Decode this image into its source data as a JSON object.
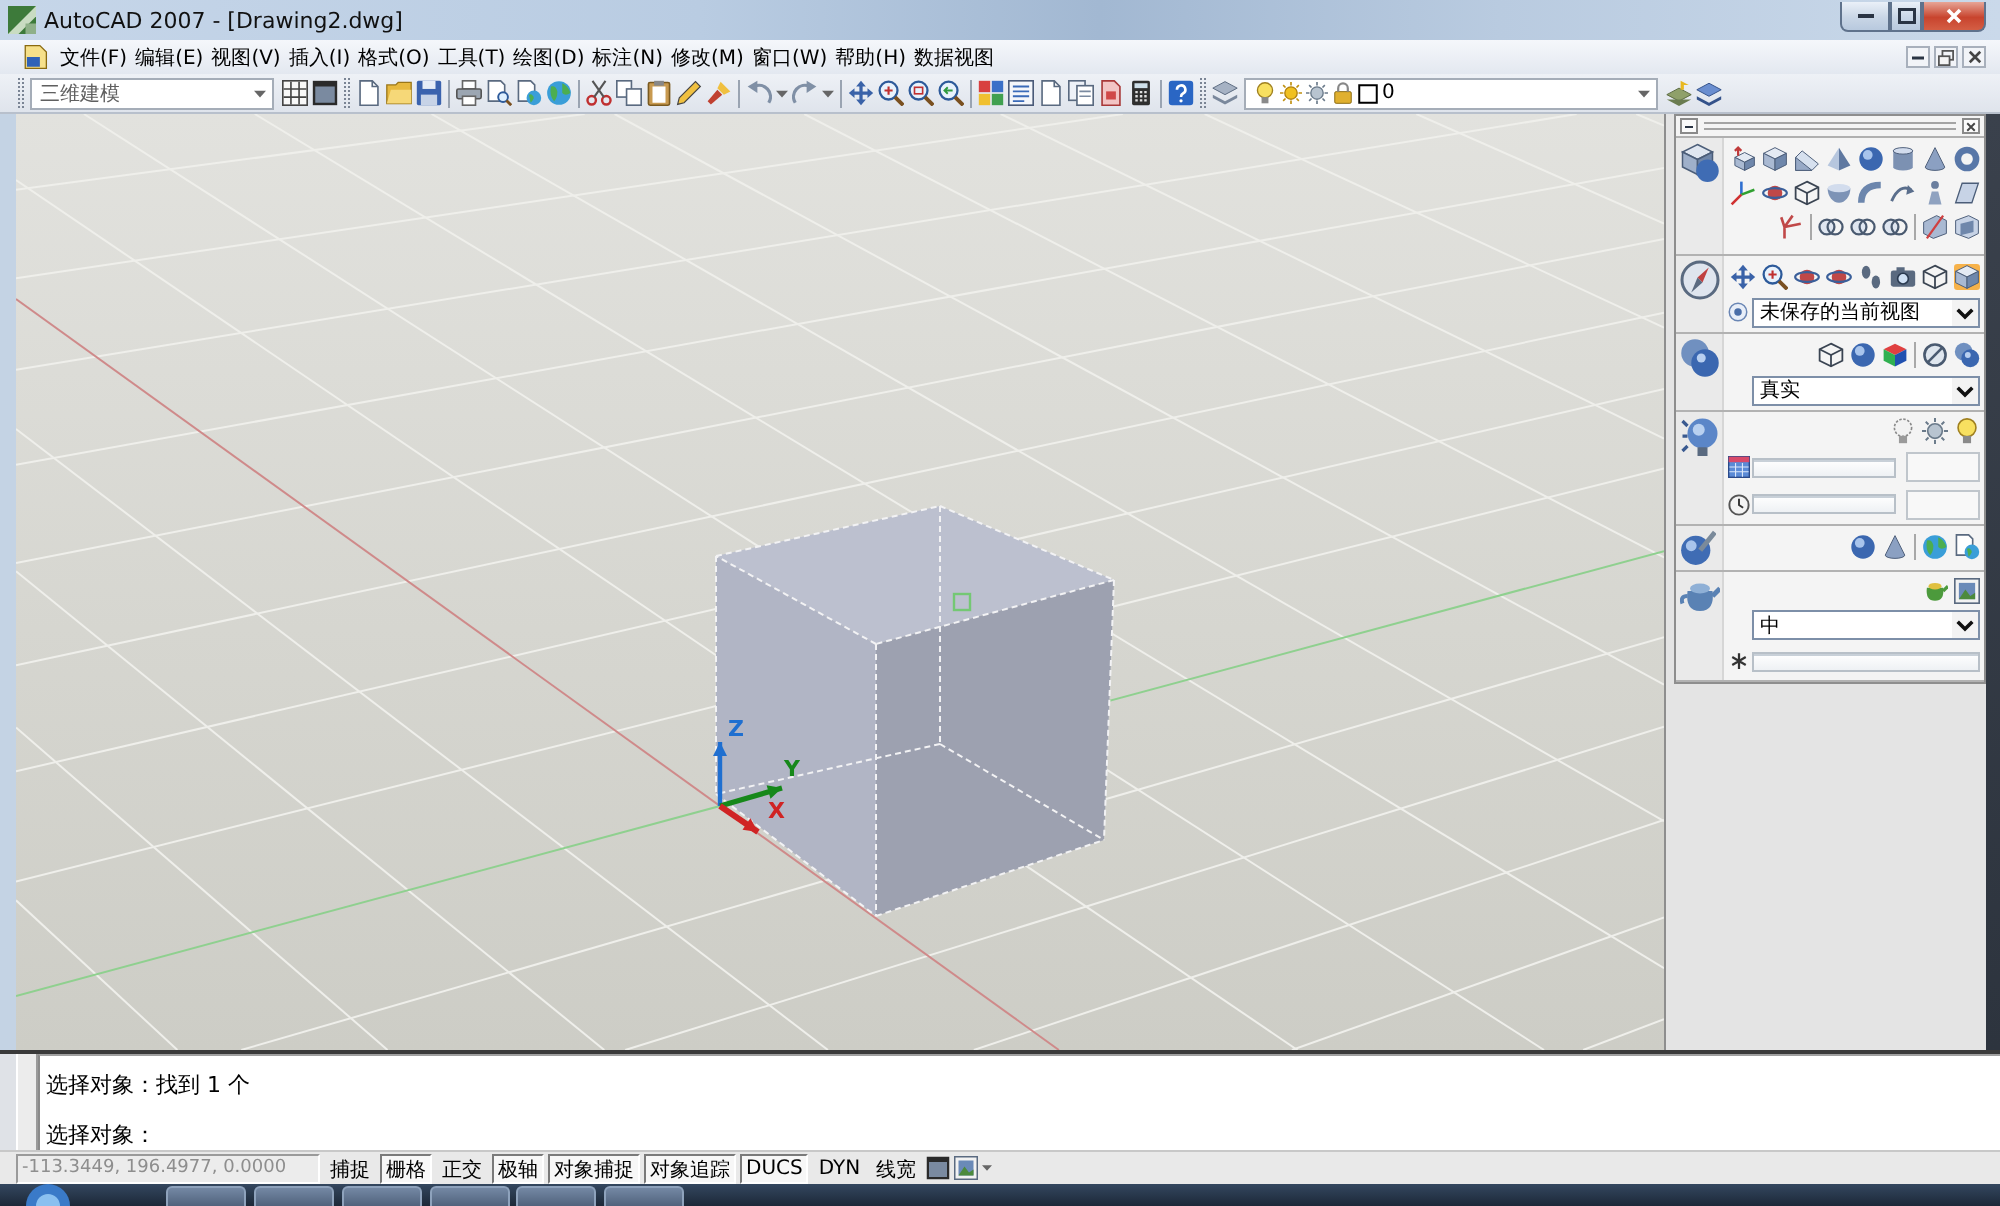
{
  "window": {
    "title": "AutoCAD 2007 - [Drawing2.dwg]"
  },
  "menu_bar": {
    "items": [
      "文件(F)",
      "编辑(E)",
      "视图(V)",
      "插入(I)",
      "格式(O)",
      "工具(T)",
      "绘图(D)",
      "标注(N)",
      "修改(M)",
      "窗口(W)",
      "帮助(H)",
      "数据视图"
    ]
  },
  "toolbar": {
    "workspace": "三维建模",
    "layer": "0"
  },
  "viewport": {
    "axes": [
      {
        "kind": "z",
        "label": "Z",
        "color": "#1f6fd0"
      },
      {
        "kind": "y",
        "label": "Y",
        "color": "#16881a"
      },
      {
        "kind": "x",
        "label": "X",
        "color": "#d02424"
      }
    ]
  },
  "dashboard": {
    "perspective": {
      "on": true
    },
    "view": "未保存的当前视图",
    "visual_style": "真实",
    "render_preset": "中"
  },
  "command_line": {
    "history": [
      "选择对象：找到 1 个"
    ],
    "prompt": "选择对象："
  },
  "status_bar": {
    "coordinates": "-113.3449, 196.4977, 0.0000",
    "toggles": [
      {
        "label": "捕捉",
        "on": false
      },
      {
        "label": "栅格",
        "on": true
      },
      {
        "label": "正交",
        "on": false
      },
      {
        "label": "极轴",
        "on": true
      },
      {
        "label": "对象捕捉",
        "on": true
      },
      {
        "label": "对象追踪",
        "on": true
      },
      {
        "label": "DUCS",
        "on": true
      },
      {
        "label": "DYN",
        "on": false
      },
      {
        "label": "线宽",
        "on": false
      }
    ]
  }
}
